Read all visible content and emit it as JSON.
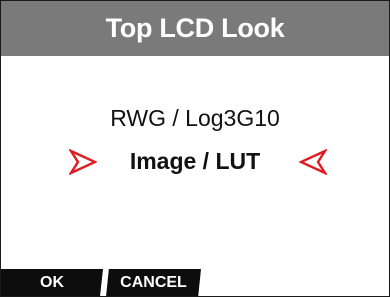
{
  "header": {
    "title": "Top LCD Look"
  },
  "main": {
    "current_value": "RWG / Log3G10",
    "selected_option": "Image / LUT",
    "left_arrow_icon": "chevron-right-outline-icon",
    "right_arrow_icon": "chevron-left-outline-icon"
  },
  "softkeys": {
    "ok_label": "OK",
    "cancel_label": "CANCEL"
  },
  "colors": {
    "title_bar": "#7a7a7a",
    "arrow_red": "#e11b22",
    "softkey_bg": "#0d0d0d",
    "text": "#111111"
  }
}
